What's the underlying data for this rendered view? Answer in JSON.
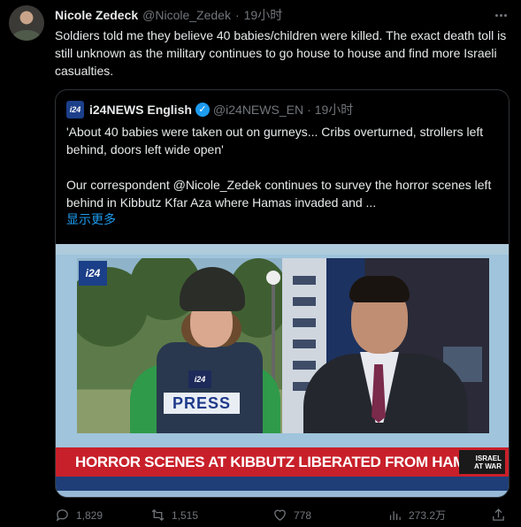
{
  "tweet": {
    "author_name": "Nicole Zedeck",
    "author_handle": "@Nicole_Zedek",
    "separator": "·",
    "time": "19小时",
    "text": "Soldiers told me they believe 40 babies/children were killed. The exact death toll is still unknown as the military continues to go house to house and find more Israeli casualties."
  },
  "quote": {
    "avatar_label": "i24",
    "author_name": "i24NEWS English",
    "verified_glyph": "✓",
    "author_handle": "@i24NEWS_EN",
    "separator": "·",
    "time": "19小时",
    "paragraph1": "'About 40 babies were taken out on gurneys... Cribs overturned, strollers left behind, doors left wide open'",
    "paragraph2": "Our correspondent @Nicole_Zedek continues to survey the horror scenes left behind in Kibbutz Kfar Aza where Hamas invaded and ...",
    "show_more": "显示更多"
  },
  "media": {
    "station_logo": "i24",
    "mic_flag": "i24",
    "press_label": "PRESS",
    "banner": "HORROR SCENES AT KIBBUTZ LIBERATED FROM HAMAS",
    "badge_line1": "ISRAEL",
    "badge_line2": "AT WAR"
  },
  "actions": {
    "replies": "1,829",
    "retweets": "1,515",
    "likes": "778",
    "views": "273.2万"
  },
  "icons": {
    "more": "more-icon",
    "reply": "reply-icon",
    "retweet": "retweet-icon",
    "like": "heart-icon",
    "views": "views-icon",
    "share": "share-icon",
    "verified": "verified-icon"
  },
  "colors": {
    "background": "#000000",
    "text": "#e7e9ea",
    "muted": "#71767b",
    "link": "#1d9bf0",
    "banner": "#c8202a"
  }
}
